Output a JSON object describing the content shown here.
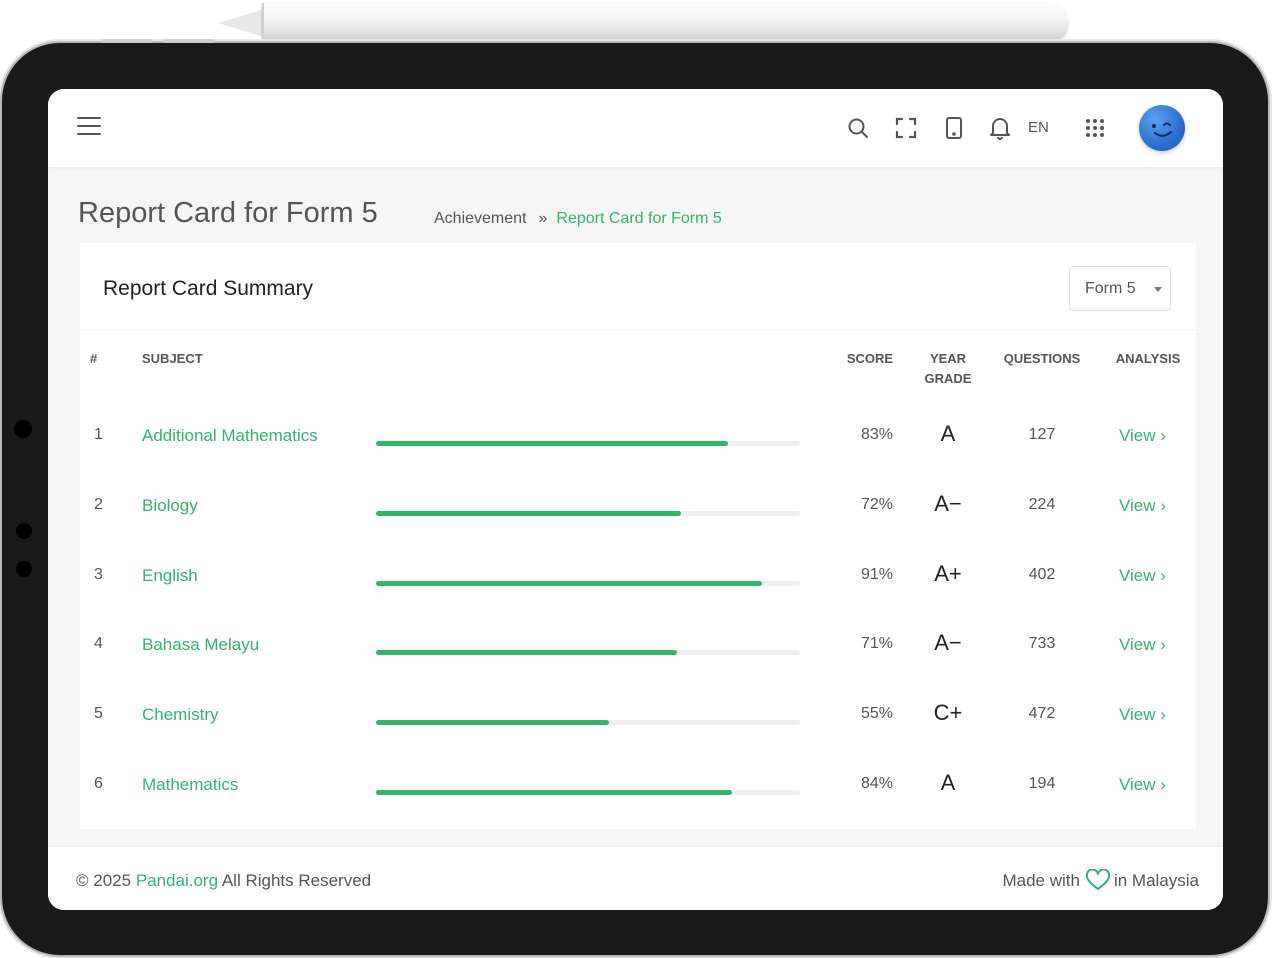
{
  "header": {
    "language": "EN",
    "icons": [
      "menu-icon",
      "search-icon",
      "fullscreen-icon",
      "tablet-icon",
      "bell-icon",
      "apps-grid-icon"
    ]
  },
  "page": {
    "title": "Report Card for Form 5",
    "breadcrumb": {
      "parent": "Achievement",
      "separator": "»",
      "current": "Report Card for Form 5"
    }
  },
  "card": {
    "title": "Report Card Summary",
    "form_select": {
      "value": "Form 5"
    },
    "columns": {
      "num": "#",
      "subject": "SUBJECT",
      "score": "SCORE",
      "year_grade_line1": "YEAR",
      "year_grade_line2": "GRADE",
      "questions": "QUESTIONS",
      "analysis": "ANALYSIS"
    },
    "rows": [
      {
        "num": "1",
        "subject": "Additional Mathematics",
        "progress": 0.83,
        "score": "83%",
        "grade": "A",
        "questions": "127",
        "view": "View ›"
      },
      {
        "num": "2",
        "subject": "Biology",
        "progress": 0.72,
        "score": "72%",
        "grade": "A−",
        "questions": "224",
        "view": "View ›"
      },
      {
        "num": "3",
        "subject": "English",
        "progress": 0.91,
        "score": "91%",
        "grade": "A+",
        "questions": "402",
        "view": "View ›"
      },
      {
        "num": "4",
        "subject": "Bahasa Melayu",
        "progress": 0.71,
        "score": "71%",
        "grade": "A−",
        "questions": "733",
        "view": "View ›"
      },
      {
        "num": "5",
        "subject": "Chemistry",
        "progress": 0.55,
        "score": "55%",
        "grade": "C+",
        "questions": "472",
        "view": "View ›"
      },
      {
        "num": "6",
        "subject": "Mathematics",
        "progress": 0.84,
        "score": "84%",
        "grade": "A",
        "questions": "194",
        "view": "View ›"
      }
    ]
  },
  "footer": {
    "copyright_prefix": "© 2025",
    "brand": "Pandai.org",
    "copyright_suffix": "All Rights Reserved",
    "made_prefix": "Made with",
    "made_suffix": "in Malaysia"
  },
  "colors": {
    "accent": "#34b36a",
    "device_frame": "#1a1a1a",
    "page_background": "#f6f6f6"
  }
}
